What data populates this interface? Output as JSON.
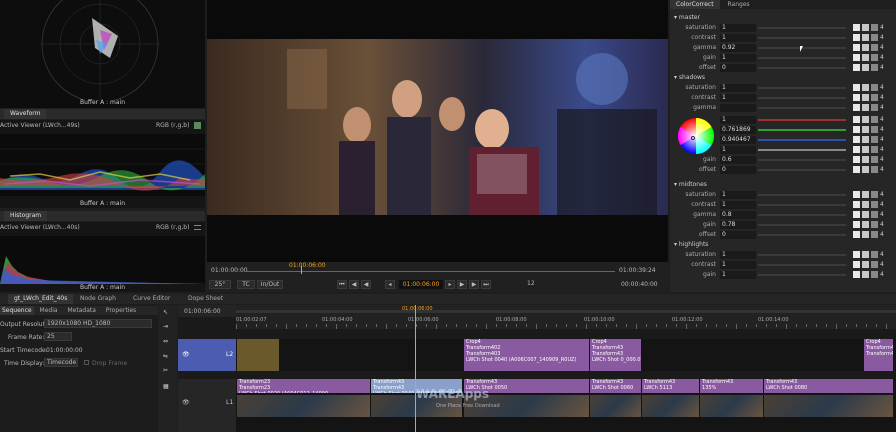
{
  "scopes": {
    "vectorscope_caption": "Buffer A : main",
    "waveform_tab": "Waveform",
    "waveform_viewer": "Active Viewer (LWch...49s)",
    "waveform_mode": "RGB (r,g,b)",
    "waveform_caption": "Buffer A : main",
    "histogram_tab": "Histogram",
    "histogram_viewer": "Active Viewer (LWch...40s)",
    "histogram_mode": "RGB (r,g,b)",
    "histogram_caption": "Buffer A : main"
  },
  "viewer": {
    "tc_start": "01:00:00:00",
    "tc_marker": "01:00:06:00",
    "tc_end": "01:00:39:24",
    "zoom": "25°",
    "tc_mode": "TC",
    "inout": "In/Out",
    "current_tc": "01:00:06:00",
    "step": "12",
    "duration": "00:00:40:00",
    "ruler_labels": [
      "01:00:00:00",
      "01:00:04:00",
      "01:00:08:00",
      "01:00:12:00",
      "01:00:16:00",
      "01:00:20:00",
      "01:00:24:00",
      "01:00:28:00",
      "01:00:32:00",
      "01:00:36:00"
    ]
  },
  "colorcorrect": {
    "tabs": [
      "ColorCorrect",
      "Ranges"
    ],
    "sections": [
      {
        "name": "master",
        "rows": [
          {
            "label": "saturation",
            "value": "1"
          },
          {
            "label": "contrast",
            "value": "1"
          },
          {
            "label": "gamma",
            "value": "0.92"
          },
          {
            "label": "gain",
            "value": "1"
          },
          {
            "label": "offset",
            "value": "0"
          }
        ]
      },
      {
        "name": "shadows",
        "rows": [
          {
            "label": "saturation",
            "value": "1"
          },
          {
            "label": "contrast",
            "value": "1"
          },
          {
            "label": "gamma",
            "value": ""
          }
        ]
      },
      {
        "name": "",
        "rows": [
          {
            "label": "",
            "value": "1"
          },
          {
            "label": "",
            "value": "0.761869"
          },
          {
            "label": "",
            "value": "0.940467"
          },
          {
            "label": "",
            "value": "1"
          },
          {
            "label": "gain",
            "value": "0.6"
          },
          {
            "label": "offset",
            "value": "0"
          }
        ]
      },
      {
        "name": "midtones",
        "rows": [
          {
            "label": "saturation",
            "value": "1"
          },
          {
            "label": "contrast",
            "value": "1"
          },
          {
            "label": "gamma",
            "value": "0.8"
          },
          {
            "label": "gain",
            "value": "0.78"
          },
          {
            "label": "offset",
            "value": "0"
          }
        ]
      },
      {
        "name": "highlights",
        "rows": [
          {
            "label": "saturation",
            "value": "1"
          },
          {
            "label": "contrast",
            "value": "1"
          },
          {
            "label": "gain",
            "value": "1"
          }
        ]
      }
    ],
    "channel_value": "4"
  },
  "bottom_tabs": [
    "gt_LWch_Edit_40s",
    "Node Graph",
    "Curve Editor",
    "Dope Sheet"
  ],
  "sequence": {
    "tabs": [
      "Sequence",
      "Media",
      "Metadata",
      "Properties"
    ],
    "output_label": "Output Resolution:",
    "output_value": "1920x1080 HD_1080",
    "framerate_label": "Frame Rate:",
    "framerate_value": "25",
    "start_label": "Start Timecode:",
    "start_value": "01:00:00:00",
    "display_label": "Time Display:",
    "display_value": "Timecode",
    "dropframe_label": "Drop Frame"
  },
  "timeline": {
    "current_tc": "01:00:06:00",
    "playhead_tc": "01:00:06:00",
    "ruler": [
      "01:00:02:07",
      "01:00:04:00",
      "01:00:06:00",
      "01:00:08:00",
      "01:00:10:00",
      "01:00:12:00",
      "01:00:14:00"
    ],
    "track_v2": "L2",
    "track_v1": "L1",
    "v2_clips": [
      {
        "text": "Crop4\nTransform402\nTransform403\nLWCh Shot 0040 (A006C007_140909_R0UZ)"
      },
      {
        "text": "Crop4\nTransform43\nTransform43\nLWCh Shot 0_000.0%"
      },
      {
        "text": "Crop4\nTransform43\nTransform43"
      }
    ],
    "v1_clips": [
      {
        "text": "Transform23\nTransform23\nLWCh Shot 0020 (A004C012_14090"
      },
      {
        "text": "Transform43\nTransform43\nLWCh Shot 0040 (A006C007_140909_R0UZ)"
      },
      {
        "text": "Transform43\nLWCh Shot 0050"
      },
      {
        "text": "Transform43\nLWCh Shot 0060"
      },
      {
        "text": "Transform43\nLWCh 5113"
      },
      {
        "text": "Transform43\n135%"
      },
      {
        "text": "Transform43\nLWCh Shot 0080"
      }
    ],
    "watermark": "WAREApps",
    "watermark_sub": "One Place Free Download"
  },
  "colors": {
    "bg": "#1e1e1e",
    "panel": "#151515",
    "track_blue": "#4c5cb0",
    "clip_purple": "#8a5aa0",
    "playhead": "#f0a020"
  }
}
